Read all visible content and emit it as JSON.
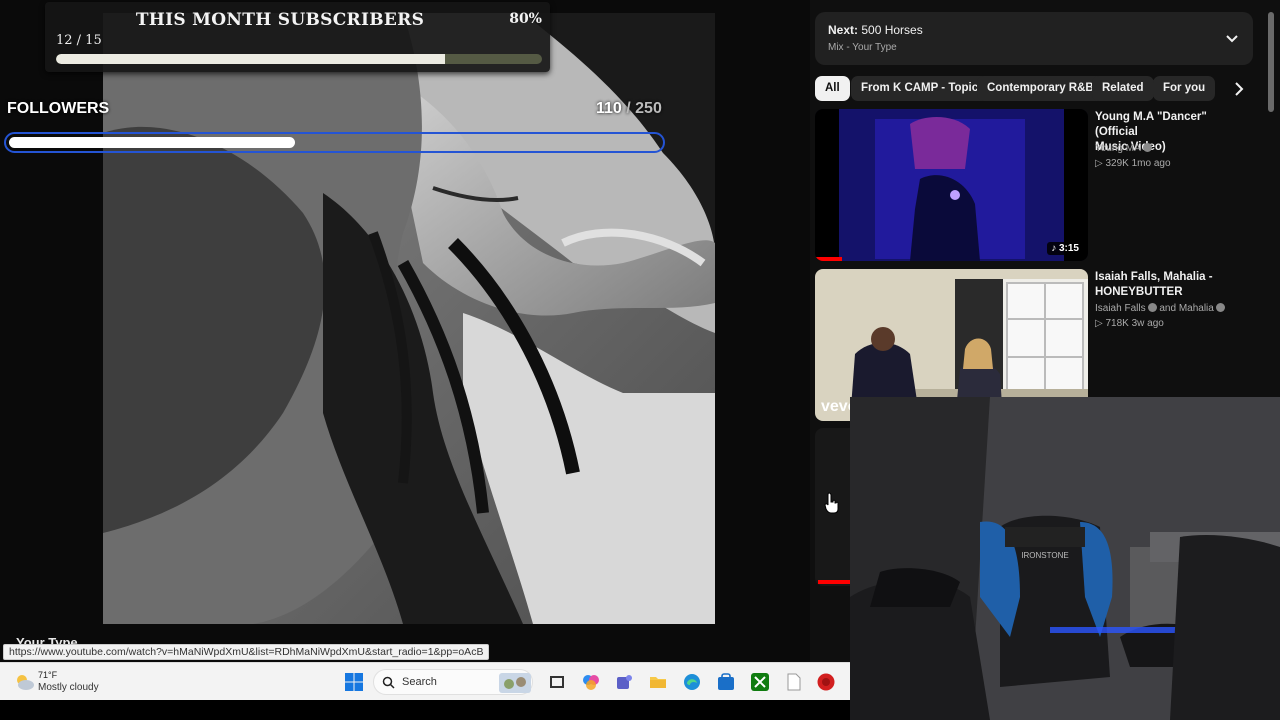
{
  "player": {
    "under_title": "Your Type",
    "status_url": "https://www.youtube.com/watch?v=hMaNiWpdXmU&list=RDhMaNiWpdXmU&start_radio=1&pp=oAcB"
  },
  "subscribers_overlay": {
    "title": "THIS MONTH SUBSCRIBERS",
    "count": "12 / 15",
    "percent": "80%",
    "progress": 0.8
  },
  "followers_overlay": {
    "label": "FOLLOWERS",
    "current": "110",
    "separator": " / ",
    "goal": "250",
    "progress": 0.44
  },
  "up_next": {
    "label_bold": "Next:",
    "title": "500 Horses",
    "subtitle": "Mix - Your Type"
  },
  "chips": [
    "All",
    "From K CAMP - Topic",
    "Contemporary R&B",
    "Related",
    "For you"
  ],
  "videos": [
    {
      "title_line1": "Young M.A \"Dancer\" (Official",
      "title_line2": "Music Video)",
      "channel": "Young MA",
      "meta": "▷ 329K  1mo ago",
      "duration": "♪ 3:15",
      "watched": 0.1
    },
    {
      "title_line1": "Isaiah Falls, Mahalia -",
      "title_line2": "HONEYBUTTER",
      "channel": "Isaiah Falls",
      "channel_extra": "and Mahalia",
      "meta": "▷ 718K  3w ago",
      "badge": "vevo"
    }
  ],
  "taskbar": {
    "temperature": "71°F",
    "weather": "Mostly cloudy",
    "search_placeholder": "Search"
  },
  "colors": {
    "accent_blue": "#2454d4",
    "youtube_red": "#ff0000",
    "sub_bar_track": "#555a44",
    "sub_bar_fill": "#ecebe2"
  }
}
